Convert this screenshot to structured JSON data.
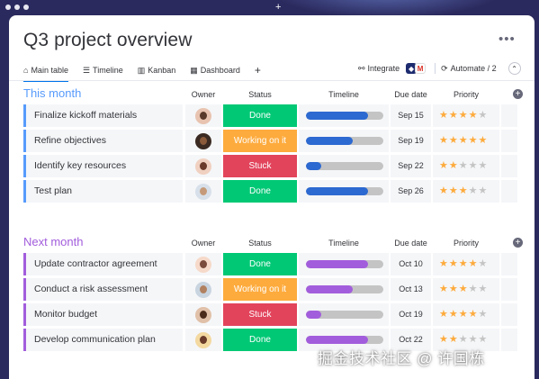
{
  "page_title": "Q3 project overview",
  "tabs": [
    {
      "label": "Main table",
      "icon": "home-icon"
    },
    {
      "label": "Timeline",
      "icon": "timeline-icon"
    },
    {
      "label": "Kanban",
      "icon": "kanban-icon"
    },
    {
      "label": "Dashboard",
      "icon": "dashboard-icon"
    }
  ],
  "toolbar": {
    "integrate_label": "Integrate",
    "automate_label": "Automate / 2"
  },
  "columns": {
    "owner": "Owner",
    "status": "Status",
    "timeline": "Timeline",
    "due": "Due date",
    "priority": "Priority"
  },
  "colors": {
    "done": "#00c875",
    "working": "#fdab3d",
    "stuck": "#e2445c",
    "this_month": "#579bfc",
    "next_month": "#a25ddc",
    "timeline_blue": "#2c69d1",
    "timeline_purple": "#a25ddc"
  },
  "groups": [
    {
      "title": "This month",
      "color": "#579bfc",
      "rows": [
        {
          "name": "Finalize kickoff materials",
          "status": "Done",
          "status_color": "#00c875",
          "timeline_progress": 0.8,
          "due": "Sep 15",
          "priority": 4
        },
        {
          "name": "Refine objectives",
          "status": "Working on it",
          "status_color": "#fdab3d",
          "timeline_progress": 0.6,
          "due": "Sep 19",
          "priority": 5
        },
        {
          "name": "Identify key resources",
          "status": "Stuck",
          "status_color": "#e2445c",
          "timeline_progress": 0.2,
          "due": "Sep 22",
          "priority": 2
        },
        {
          "name": "Test plan",
          "status": "Done",
          "status_color": "#00c875",
          "timeline_progress": 0.8,
          "due": "Sep 26",
          "priority": 3
        }
      ]
    },
    {
      "title": "Next month",
      "color": "#a25ddc",
      "rows": [
        {
          "name": "Update contractor agreement",
          "status": "Done",
          "status_color": "#00c875",
          "timeline_progress": 0.8,
          "due": "Oct 10",
          "priority": 4
        },
        {
          "name": "Conduct a risk assessment",
          "status": "Working on it",
          "status_color": "#fdab3d",
          "timeline_progress": 0.6,
          "due": "Oct 13",
          "priority": 3
        },
        {
          "name": "Monitor budget",
          "status": "Stuck",
          "status_color": "#e2445c",
          "timeline_progress": 0.2,
          "due": "Oct 19",
          "priority": 4
        },
        {
          "name": "Develop communication plan",
          "status": "Done",
          "status_color": "#00c875",
          "timeline_progress": 0.8,
          "due": "Oct 22",
          "priority": 2
        }
      ]
    }
  ],
  "watermark": "掘金技术社区 @ 许国栋"
}
